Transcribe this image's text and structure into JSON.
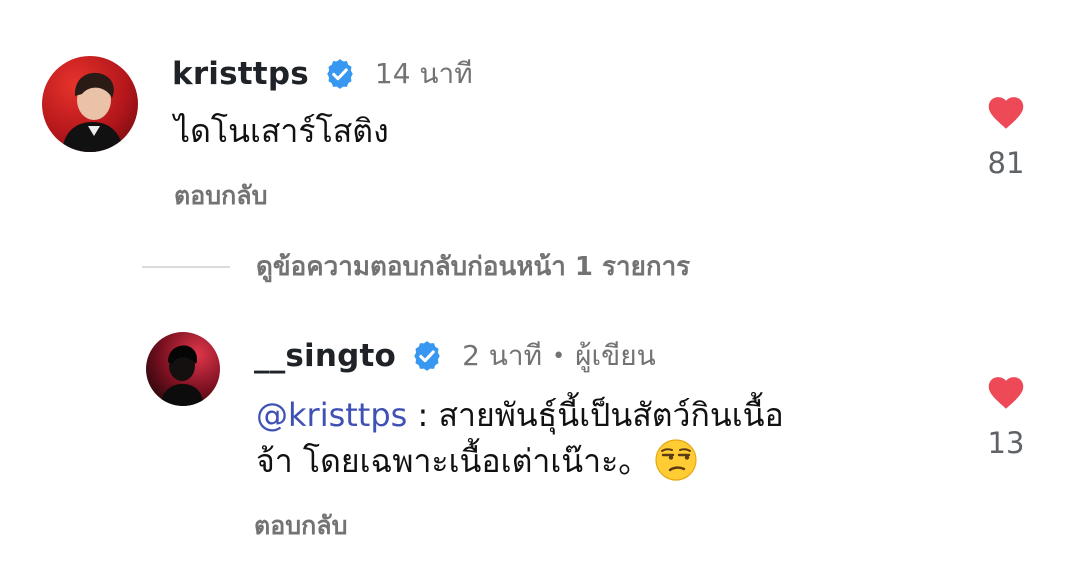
{
  "comments": [
    {
      "username": "kristtps",
      "time": "14 นาที",
      "text": "ไดโนเสาร์โสติง",
      "reply_label": "ตอบกลับ",
      "likes": "81",
      "avatar_icon": "user-avatar-photo"
    },
    {
      "username": "__singto",
      "time": "2 นาที",
      "role_separator": "•",
      "role": "ผู้เขียน",
      "mention": "@kristtps",
      "text_line1": " : สายพันธุ์นี้เป็นสัตว์กินเนื้อ",
      "text_line2": "จ้า โดยเฉพาะเนื้อเต่าเน๊าะ。",
      "emoji": "unamused-face-emoji",
      "reply_label": "ตอบกลับ",
      "likes": "13",
      "avatar_icon": "user-avatar-photo"
    }
  ],
  "view_replies_label": "ดูข้อความตอบกลับก่อนหน้า 1 รายการ",
  "colors": {
    "verified": "#3897f0",
    "heart": "#ed4956",
    "mention": "#3f51b5",
    "secondary_text": "#737373"
  }
}
